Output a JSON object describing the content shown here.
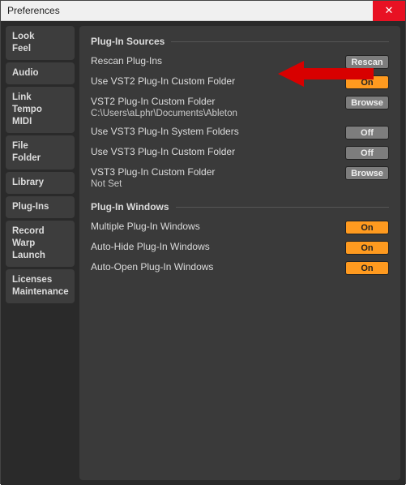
{
  "window": {
    "title": "Preferences",
    "close_glyph": "✕"
  },
  "sidebar": {
    "groups": [
      [
        "Look",
        "Feel"
      ],
      [
        "Audio"
      ],
      [
        "Link",
        "Tempo",
        "MIDI"
      ],
      [
        "File",
        "Folder"
      ],
      [
        "Library"
      ],
      [
        "Plug-Ins"
      ],
      [
        "Record",
        "Warp",
        "Launch"
      ],
      [
        "Licenses",
        "Maintenance"
      ]
    ]
  },
  "content": {
    "section1_title": "Plug-In Sources",
    "section2_title": "Plug-In Windows",
    "rows1": [
      {
        "label": "Rescan Plug-Ins",
        "ctrl_text": "Rescan",
        "ctrl_kind": "btn"
      },
      {
        "label": "Use VST2 Plug-In Custom Folder",
        "ctrl_text": "On",
        "ctrl_kind": "on"
      },
      {
        "label": "VST2 Plug-In Custom Folder",
        "sub": "C:\\Users\\aLphr\\Documents\\Ableton",
        "ctrl_text": "Browse",
        "ctrl_kind": "btn"
      },
      {
        "label": "Use VST3 Plug-In System Folders",
        "ctrl_text": "Off",
        "ctrl_kind": "off"
      },
      {
        "label": "Use VST3 Plug-In Custom Folder",
        "ctrl_text": "Off",
        "ctrl_kind": "off"
      },
      {
        "label": "VST3 Plug-In Custom Folder",
        "sub": "Not Set",
        "ctrl_text": "Browse",
        "ctrl_kind": "btn"
      }
    ],
    "rows2": [
      {
        "label": "Multiple Plug-In Windows",
        "ctrl_text": "On",
        "ctrl_kind": "on"
      },
      {
        "label": "Auto-Hide Plug-In Windows",
        "ctrl_text": "On",
        "ctrl_kind": "on"
      },
      {
        "label": "Auto-Open Plug-In Windows",
        "ctrl_text": "On",
        "ctrl_kind": "on"
      }
    ]
  }
}
